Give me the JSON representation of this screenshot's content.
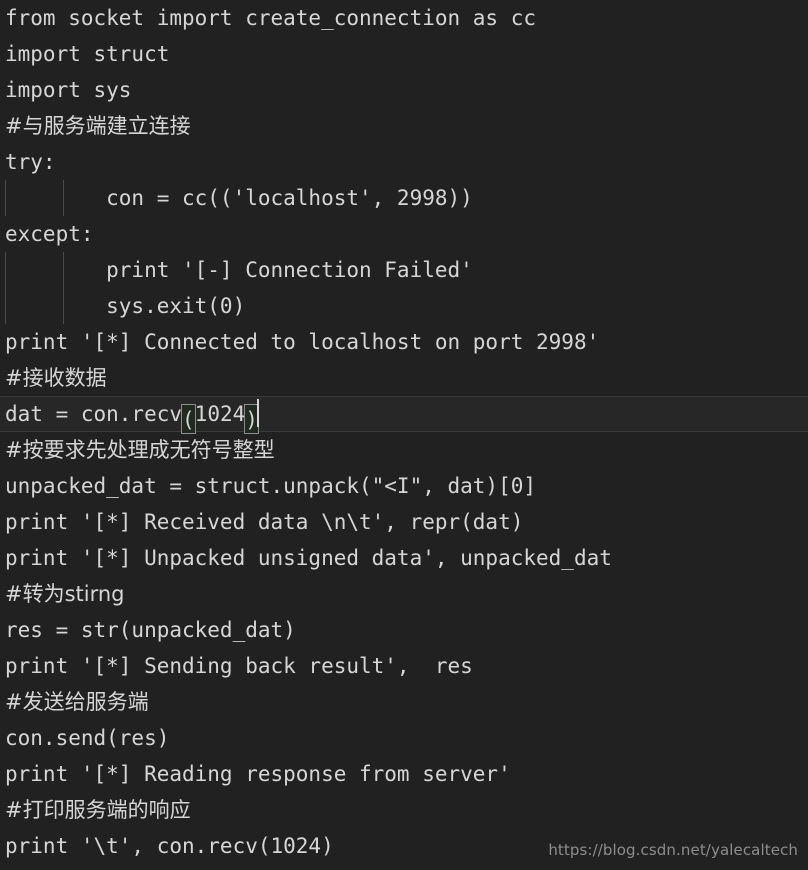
{
  "editor": {
    "background_color": "#212121",
    "foreground_color": "#d6d6d6",
    "current_line_color": "#272727",
    "indent_guide_color": "#4a4a4a",
    "bracket_match_border_color": "#8c8c8c",
    "caret_color": "#d8d8d8",
    "watermark_color": "#8d8d8d",
    "language": "Python",
    "font_size_px": 21,
    "line_height_px": 36,
    "total_lines": 24,
    "current_line_number": 12
  },
  "watermark": {
    "text": "https://blog.csdn.net/yalecaltech"
  },
  "lines": [
    {
      "n": 1,
      "text": "from socket import create_connection as cc",
      "kind": "code",
      "guides": 0,
      "current": false
    },
    {
      "n": 2,
      "text": "import struct",
      "kind": "code",
      "guides": 0,
      "current": false
    },
    {
      "n": 3,
      "text": "import sys",
      "kind": "code",
      "guides": 0,
      "current": false
    },
    {
      "n": 4,
      "text": "#与服务端建立连接",
      "kind": "comment",
      "guides": 0,
      "current": false
    },
    {
      "n": 5,
      "text": "try:",
      "kind": "code",
      "guides": 0,
      "current": false
    },
    {
      "n": 6,
      "text": "        con = cc(('localhost', 2998))",
      "kind": "code",
      "guides": 2,
      "current": false
    },
    {
      "n": 7,
      "text": "except:",
      "kind": "code",
      "guides": 0,
      "current": false
    },
    {
      "n": 8,
      "text": "        print '[-] Connection Failed'",
      "kind": "code",
      "guides": 2,
      "current": false
    },
    {
      "n": 9,
      "text": "        sys.exit(0)",
      "kind": "code",
      "guides": 2,
      "current": false
    },
    {
      "n": 10,
      "text": "print '[*] Connected to localhost on port 2998'",
      "kind": "code",
      "guides": 0,
      "current": false
    },
    {
      "n": 11,
      "text": "#接收数据",
      "kind": "comment",
      "guides": 0,
      "current": false
    },
    {
      "n": 12,
      "text": "dat = con.recv(1024)",
      "kind": "code",
      "guides": 0,
      "current": true
    },
    {
      "n": 13,
      "text": "#按要求先处理成无符号整型",
      "kind": "comment",
      "guides": 0,
      "current": false
    },
    {
      "n": 14,
      "text": "unpacked_dat = struct.unpack(\"<I\", dat)[0]",
      "kind": "code",
      "guides": 0,
      "current": false
    },
    {
      "n": 15,
      "text": "print '[*] Received data \\n\\t', repr(dat)",
      "kind": "code",
      "guides": 0,
      "current": false
    },
    {
      "n": 16,
      "text": "print '[*] Unpacked unsigned data', unpacked_dat",
      "kind": "code",
      "guides": 0,
      "current": false
    },
    {
      "n": 17,
      "text": "#转为stirng",
      "kind": "comment",
      "guides": 0,
      "current": false
    },
    {
      "n": 18,
      "text": "res = str(unpacked_dat)",
      "kind": "code",
      "guides": 0,
      "current": false
    },
    {
      "n": 19,
      "text": "print '[*] Sending back result',  res",
      "kind": "code",
      "guides": 0,
      "current": false
    },
    {
      "n": 20,
      "text": "#发送给服务端",
      "kind": "comment",
      "guides": 0,
      "current": false
    },
    {
      "n": 21,
      "text": "con.send(res)",
      "kind": "code",
      "guides": 0,
      "current": false
    },
    {
      "n": 22,
      "text": "print '[*] Reading response from server'",
      "kind": "code",
      "guides": 0,
      "current": false
    },
    {
      "n": 23,
      "text": "#打印服务端的响应",
      "kind": "comment",
      "guides": 0,
      "current": false
    },
    {
      "n": 24,
      "text": "print '\\t', con.recv(1024)",
      "kind": "code",
      "guides": 0,
      "current": false
    }
  ],
  "current_line_decorations": {
    "line_number": 12,
    "prefix": "dat = con.recv",
    "open_bracket": "(",
    "inner": "1024",
    "close_bracket": ")",
    "caret_after": true
  }
}
